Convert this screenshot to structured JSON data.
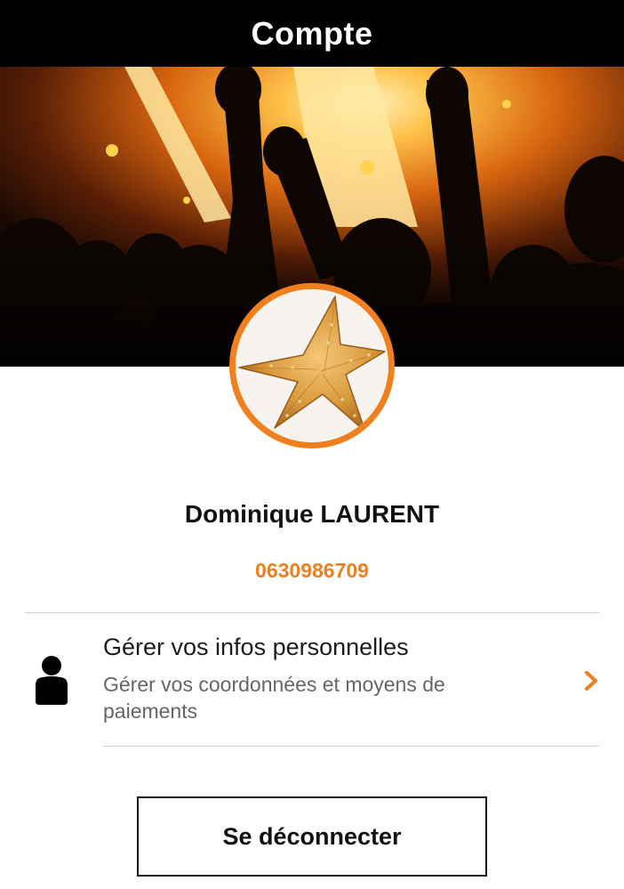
{
  "header": {
    "title": "Compte"
  },
  "hero": {
    "image": "concert-crowd-photo"
  },
  "profile": {
    "avatar_image": "starfish-photo",
    "name": "Dominique LAURENT",
    "phone": "0630986709"
  },
  "menu": {
    "items": [
      {
        "icon": "person-icon",
        "title": "Gérer vos infos personnelles",
        "subtitle": "Gérer vos coordonnées et moyens de paiements",
        "trailing_icon": "chevron-right-icon"
      }
    ]
  },
  "actions": {
    "logout_label": "Se déconnecter"
  },
  "colors": {
    "accent": "#f07f1e",
    "header_bg": "#000000",
    "text_primary": "#111111",
    "text_secondary": "#666666",
    "divider": "#cfcfcf"
  }
}
